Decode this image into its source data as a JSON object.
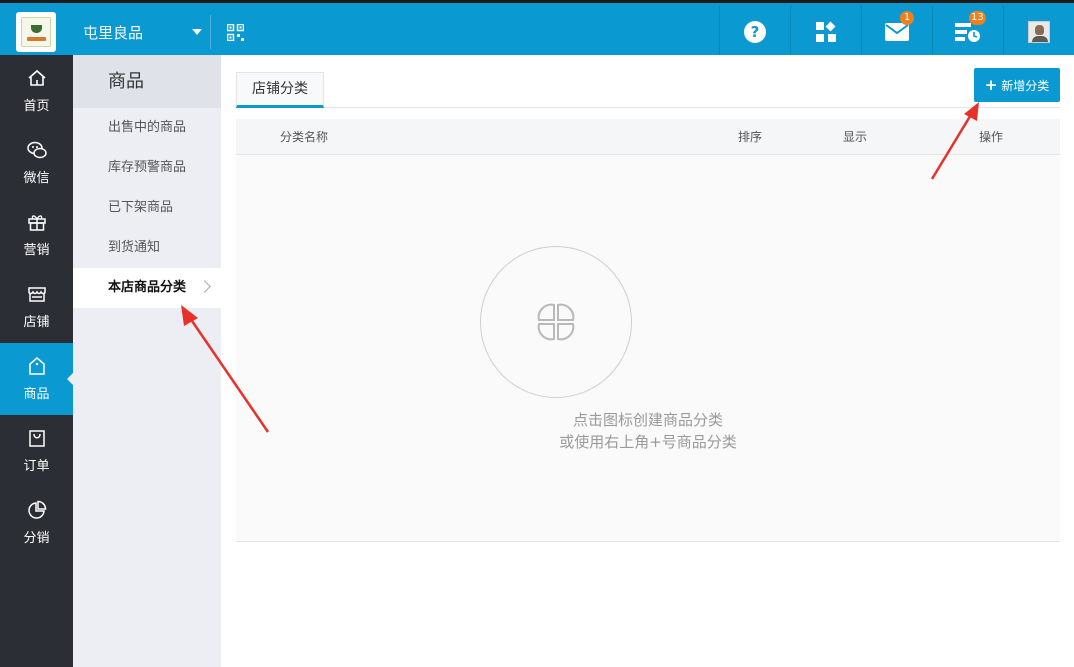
{
  "header": {
    "store_name": "屯里良品",
    "notifications": {
      "mail_count": "1",
      "tasks_count": "13"
    }
  },
  "left_nav": {
    "items": [
      {
        "label": "首页",
        "icon": "home-icon"
      },
      {
        "label": "微信",
        "icon": "wechat-icon"
      },
      {
        "label": "营销",
        "icon": "gift-icon"
      },
      {
        "label": "店铺",
        "icon": "store-icon"
      },
      {
        "label": "商品",
        "icon": "tag-icon",
        "active": true
      },
      {
        "label": "订单",
        "icon": "bag-icon"
      },
      {
        "label": "分销",
        "icon": "pie-icon"
      }
    ]
  },
  "sub_nav": {
    "title": "商品",
    "items": [
      {
        "label": "出售中的商品"
      },
      {
        "label": "库存预警商品"
      },
      {
        "label": "已下架商品"
      },
      {
        "label": "到货通知"
      },
      {
        "label": "本店商品分类",
        "active": true
      }
    ]
  },
  "main": {
    "tab_label": "店铺分类",
    "add_button_label": "新增分类",
    "table_headers": [
      "分类名称",
      "排序",
      "显示",
      "操作"
    ],
    "empty_state": {
      "line1": "点击图标创建商品分类",
      "line2": "或使用右上角+号商品分类"
    }
  },
  "colors": {
    "primary": "#0a9ad1",
    "nav_bg": "#2b2e34",
    "subnav_bg": "#eceef3",
    "badge": "#f07f1e",
    "arrow": "#e8312b"
  }
}
